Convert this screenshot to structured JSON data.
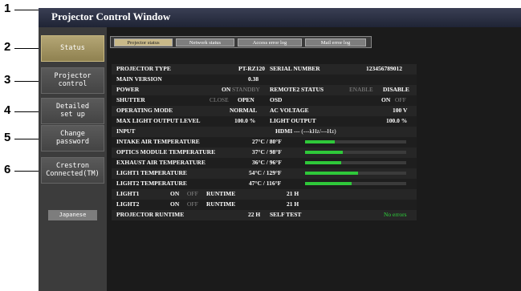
{
  "window": {
    "title": "Projector Control Window"
  },
  "callouts": [
    "1",
    "2",
    "3",
    "4",
    "5",
    "6"
  ],
  "sidebar": {
    "items": [
      {
        "label": "Status"
      },
      {
        "label": "Projector\ncontrol"
      },
      {
        "label": "Detailed\nset up"
      },
      {
        "label": "Change\npassword"
      },
      {
        "label": "Crestron\nConnected(TM)"
      }
    ],
    "language_button": "Japanese"
  },
  "tabs": [
    "Projector status",
    "Network status",
    "Access error log",
    "Mail error log"
  ],
  "status": {
    "projector_type_label": "PROJECTOR TYPE",
    "projector_type": "PT-RZ120",
    "serial_number_label": "SERIAL NUMBER",
    "serial_number": "123456789012",
    "main_version_label": "MAIN VERSION",
    "main_version": "0.38",
    "power_label": "POWER",
    "power_on": "ON",
    "power_standby": "STANDBY",
    "remote2_label": "REMOTE2 STATUS",
    "remote2_enable": "ENABLE",
    "remote2_disable": "DISABLE",
    "shutter_label": "SHUTTER",
    "shutter_close": "CLOSE",
    "shutter_open": "OPEN",
    "osd_label": "OSD",
    "osd_on": "ON",
    "osd_off": "OFF",
    "operating_mode_label": "OPERATING MODE",
    "operating_mode": "NORMAL",
    "ac_voltage_label": "AC VOLTAGE",
    "ac_voltage": "100 V",
    "max_light_label": "MAX LIGHT OUTPUT LEVEL",
    "max_light": "100.0 %",
    "light_output_label": "LIGHT OUTPUT",
    "light_output": "100.0 %",
    "input_label": "INPUT",
    "input_value": "HDMI",
    "input_freq": "--- (---kHz/---Hz)",
    "intake_label": "INTAKE AIR TEMPERATURE",
    "intake_value": "27°C / 80°F",
    "intake_level": 0.29,
    "optics_label": "OPTICS MODULE TEMPERATURE",
    "optics_value": "37°C / 98°F",
    "optics_level": 0.37,
    "exhaust_label": "EXHAUST AIR TEMPERATURE",
    "exhaust_value": "36°C / 96°F",
    "exhaust_level": 0.36,
    "light1_temp_label": "LIGHT1 TEMPERATURE",
    "light1_temp_value": "54°C / 129°F",
    "light1_temp_level": 0.52,
    "light2_temp_label": "LIGHT2 TEMPERATURE",
    "light2_temp_value": "47°C / 116°F",
    "light2_temp_level": 0.46,
    "light1_label": "LIGHT1",
    "light1_on": "ON",
    "light1_off": "OFF",
    "light1_runtime_label": "RUNTIME",
    "light1_runtime": "21 H",
    "light2_label": "LIGHT2",
    "light2_on": "ON",
    "light2_off": "OFF",
    "light2_runtime_label": "RUNTIME",
    "light2_runtime": "21 H",
    "projector_runtime_label": "PROJECTOR RUNTIME",
    "projector_runtime": "22 H",
    "self_test_label": "SELF TEST",
    "self_test": "No errors"
  },
  "colors": {
    "accent": "#c9b989",
    "bar": "#2fc83a",
    "ok": "#2ed23b"
  }
}
